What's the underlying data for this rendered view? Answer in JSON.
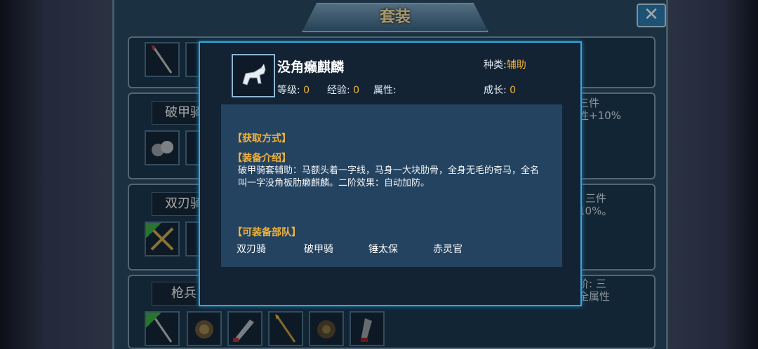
{
  "window": {
    "title": "套装",
    "close_symbol": "✕"
  },
  "rows": [
    {
      "name": "",
      "note": ""
    },
    {
      "name": "破甲骑",
      "note": "三件\n性+10%"
    },
    {
      "name": "双刃骑",
      "note": ": 三件\n10%。"
    },
    {
      "name": "枪兵",
      "note": "阶: 三\n全属性"
    }
  ],
  "item": {
    "name": "没角癞麒麟",
    "level_label": "等级:",
    "level_value": "0",
    "exp_label": "经验:",
    "exp_value": "0",
    "attr_label": "属性:",
    "attr_value": "",
    "type_label": "种类:",
    "type_value": "辅助",
    "growth_label": "成长:",
    "growth_value": "0",
    "icon": "horse-icon"
  },
  "sections": {
    "obtain_title": "【获取方式】",
    "intro_title": "【装备介绍】",
    "intro_text": "破甲骑套辅助：马额头着一字线，马身一大块肋骨，全身无毛的奇马，全名叫一字没角板肋癞麒麟。二阶效果：自动加防。",
    "troops_title": "【可装备部队】",
    "troops": [
      "双刃骑",
      "破甲骑",
      "锤太保",
      "赤灵官"
    ]
  },
  "colors": {
    "accent": "#f0b23b",
    "dialog_border": "#39a6d8",
    "equipped_ribbon": "#3fb24a"
  }
}
